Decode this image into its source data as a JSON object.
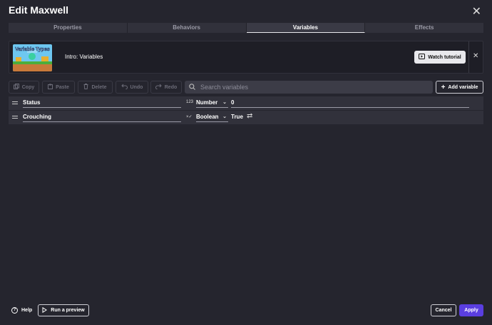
{
  "dialog": {
    "title": "Edit Maxwell",
    "close_icon": "close-icon"
  },
  "tabs": [
    {
      "label": "Properties",
      "active": false
    },
    {
      "label": "Behaviors",
      "active": false
    },
    {
      "label": "Variables",
      "active": true
    },
    {
      "label": "Effects",
      "active": false
    }
  ],
  "tutorial": {
    "thumbnail_title": "Variable Types",
    "label": "Intro: Variables",
    "watch_button": "Watch tutorial"
  },
  "toolbar": {
    "copy": "Copy",
    "paste": "Paste",
    "delete": "Delete",
    "undo": "Undo",
    "redo": "Redo",
    "search_placeholder": "Search variables",
    "add_variable": "Add variable"
  },
  "variables": [
    {
      "name": "Status",
      "type_icon": "123",
      "type": "Number",
      "value": "0"
    },
    {
      "name": "Crouching",
      "type_icon": "×✓",
      "type": "Boolean",
      "value": "True"
    }
  ],
  "footer": {
    "help": "Help",
    "run_preview": "Run a preview",
    "cancel": "Cancel",
    "apply": "Apply"
  },
  "colors": {
    "accent": "#5a3ee0",
    "background": "#25252e",
    "panel": "#31313b"
  }
}
